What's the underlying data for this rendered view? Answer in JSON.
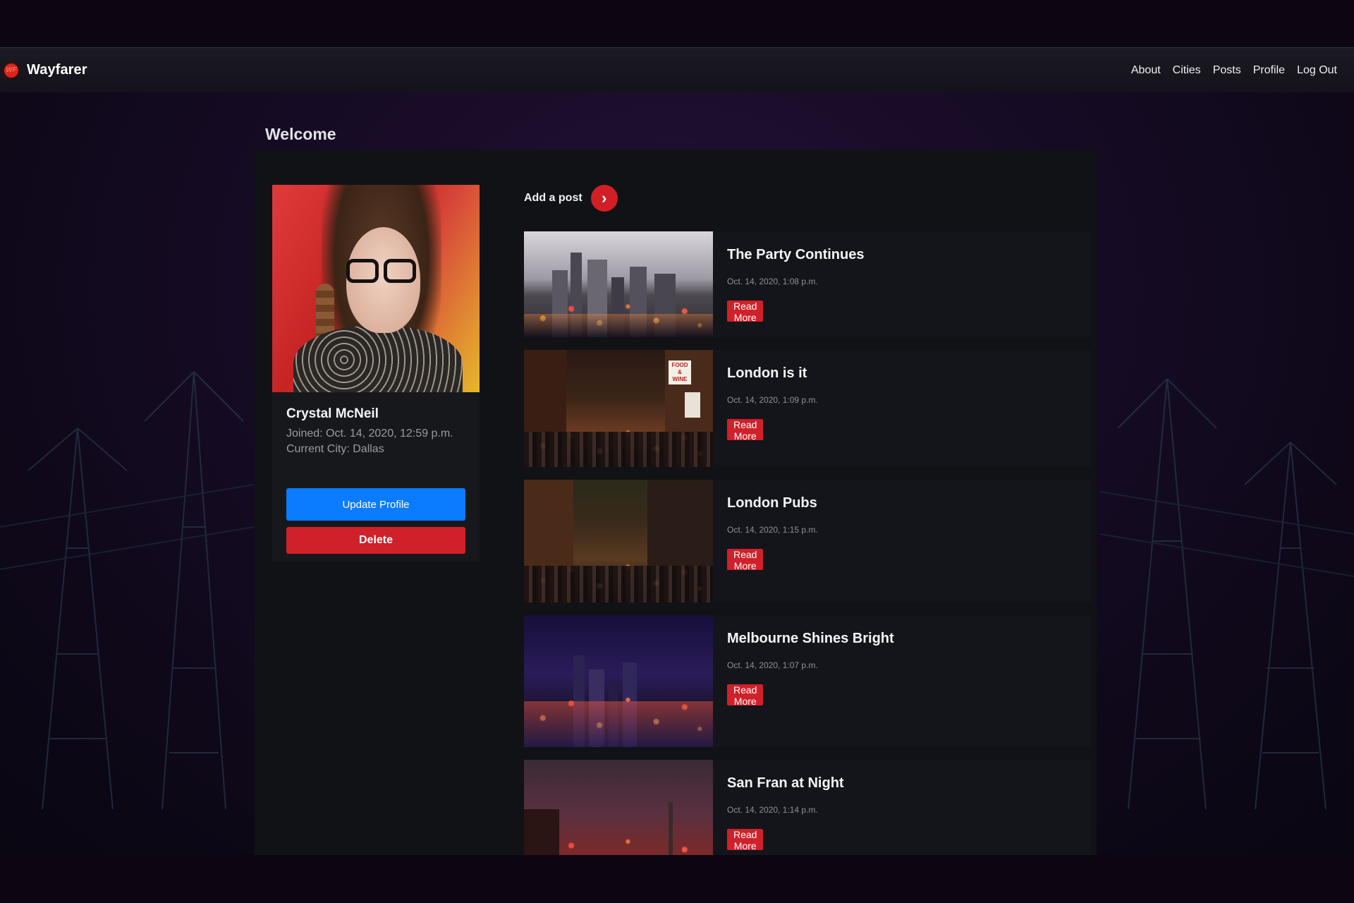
{
  "app": {
    "brand_logo_text": "WF",
    "brand_name": "Wayfarer"
  },
  "nav": {
    "links": [
      "About",
      "Cities",
      "Posts",
      "Profile",
      "Log Out"
    ]
  },
  "page": {
    "title": "Welcome"
  },
  "profile": {
    "name": "Crystal McNeil",
    "joined": "Joined: Oct. 14, 2020, 12:59 p.m.",
    "current_city": "Current City: Dallas",
    "update_label": "Update Profile",
    "delete_label": "Delete"
  },
  "add_post": {
    "label": "Add a post",
    "icon": "chevron-right-icon"
  },
  "posts": [
    {
      "title": "The Party Continues",
      "date": "Oct. 14, 2020, 1:08 p.m.",
      "read_more": "Read More",
      "image": "city-skyline-river-dusk"
    },
    {
      "title": "London is it",
      "date": "Oct. 14, 2020, 1:09 p.m.",
      "read_more": "Read More",
      "image": "busy-street-night-signs"
    },
    {
      "title": "London Pubs",
      "date": "Oct. 14, 2020, 1:15 p.m.",
      "read_more": "Read More",
      "image": "pub-street-crowd-night"
    },
    {
      "title": "Melbourne Shines Bright",
      "date": "Oct. 14, 2020, 1:07 p.m.",
      "read_more": "Read More",
      "image": "city-river-night-purple"
    },
    {
      "title": "San Fran at Night",
      "date": "Oct. 14, 2020, 1:14 p.m.",
      "read_more": "Read More",
      "image": "bay-bridge-street-night"
    }
  ],
  "colors": {
    "accent_red": "#d0202a",
    "accent_blue": "#0b7bff",
    "panel_bg": "#111216",
    "card_bg": "#14151a"
  }
}
